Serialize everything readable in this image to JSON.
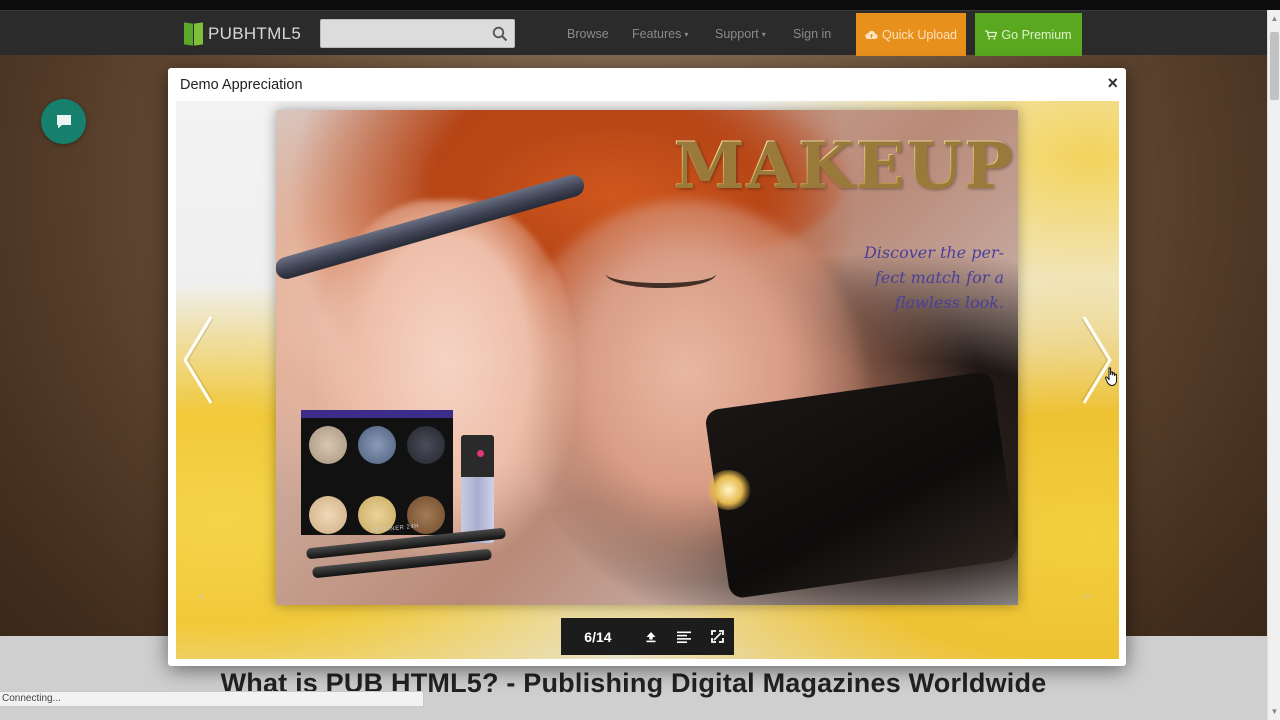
{
  "navbar": {
    "logo_text": "PUBHTML5",
    "search": {
      "placeholder": "",
      "value": "",
      "icon": "search-icon"
    },
    "links": [
      {
        "label": "Browse"
      },
      {
        "label": "Features",
        "caret": "▾"
      },
      {
        "label": "Support",
        "caret": "▾"
      },
      {
        "label": "Sign in"
      }
    ],
    "quick_upload": {
      "label": "Quick Upload",
      "icon": "cloud-upload-icon",
      "color": "#e8901c"
    },
    "go_premium": {
      "label": "Go Premium",
      "icon": "cart-icon",
      "color": "#5aa81f"
    }
  },
  "chat": {
    "icon": "chat-icon",
    "color": "#17806d"
  },
  "modal": {
    "title": "Demo Appreciation",
    "close_label": "×",
    "viewer": {
      "magazine": {
        "title": "MAKEUP",
        "tagline_lines": [
          "Discover the per-",
          "fect match for a",
          "flawless look."
        ],
        "product_label": "ARTLINER 24H"
      },
      "prev_icon": "chevron-left-icon",
      "next_icon": "chevron-right-icon",
      "toolbar": {
        "page_indicator": "6/14",
        "current_page": 6,
        "total_pages": 14,
        "buttons": [
          "first-page-icon",
          "table-of-contents-icon",
          "fullscreen-icon"
        ]
      }
    }
  },
  "background_page": {
    "headline": "What is PUB HTML5? - Publishing Digital Magazines Worldwide"
  },
  "statusbar": {
    "text": "Connecting..."
  },
  "colors": {
    "navbar": "#2b2b2b",
    "toolbar": "#1c1c1c",
    "magazine_title": "#e2bd6a",
    "tagline": "#4a3f9a"
  }
}
